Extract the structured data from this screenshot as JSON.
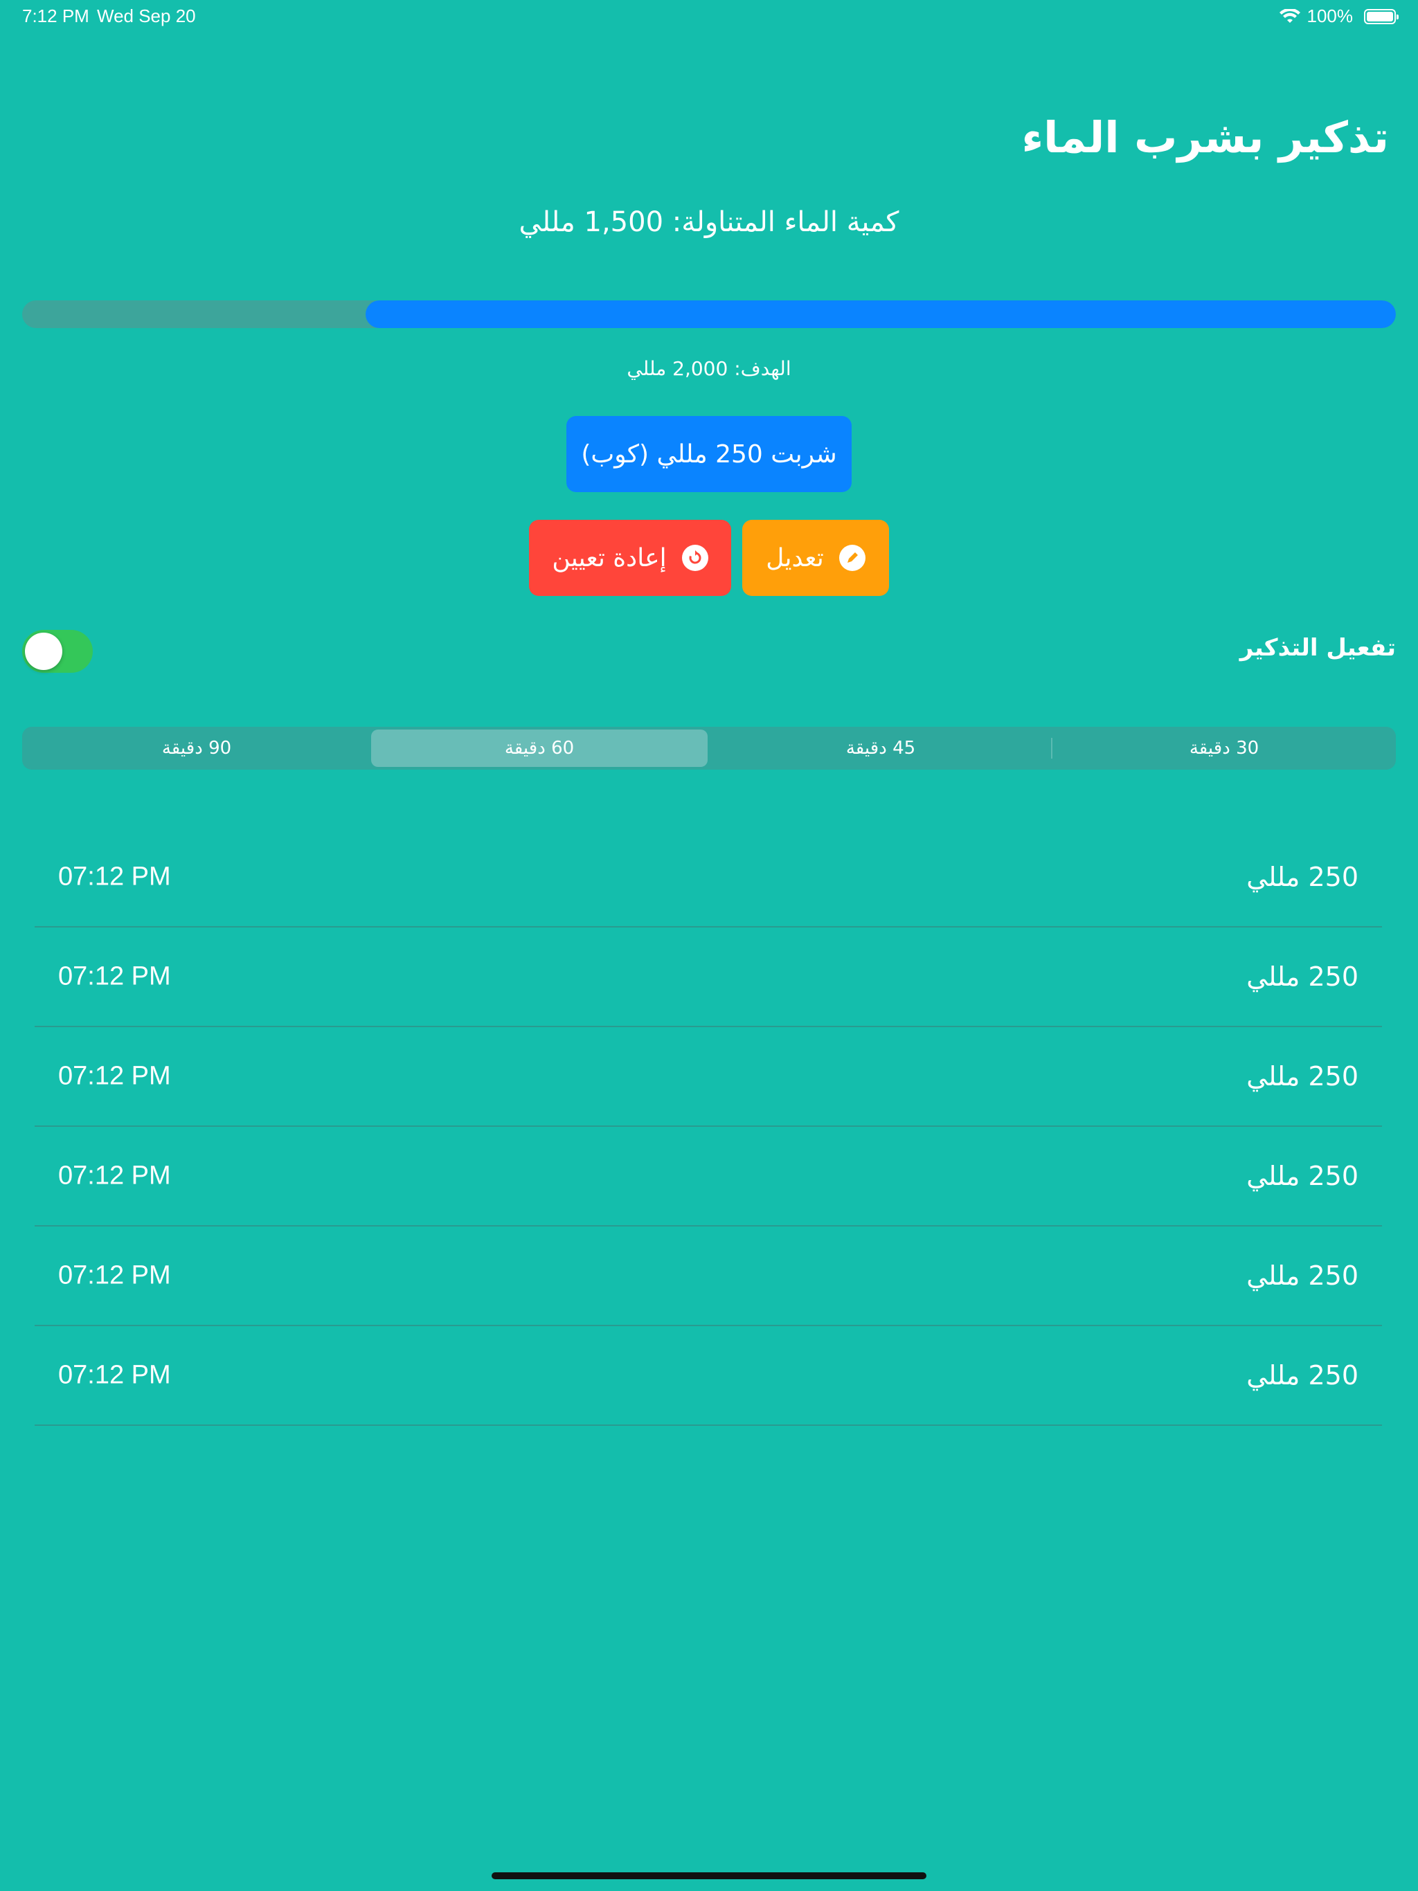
{
  "status_bar": {
    "time": "7:12 PM",
    "date": "Wed Sep 20",
    "battery": "100%",
    "wifi_icon": "wifi-icon",
    "battery_icon": "battery-icon"
  },
  "title": "تذكير بشرب الماء",
  "intake_text": "كمية الماء المتناولة: 1,500 مللي",
  "progress": {
    "fraction": 0.75,
    "fill_color": "#0A84FF",
    "track_color": "#3DA59B"
  },
  "goal_text": "الهدف: 2,000 مللي",
  "drink_button": "شربت 250 مللي (كوب)",
  "edit_button": {
    "label": "تعديل",
    "icon": "pencil-icon",
    "color": "#FF9F0A"
  },
  "reset_button": {
    "label": "إعادة تعيين",
    "icon": "reset-icon",
    "color": "#FF453A"
  },
  "reminder": {
    "label": "تفعيل التذكير",
    "enabled": true
  },
  "intervals": {
    "options": [
      "30 دقيقة",
      "45 دقيقة",
      "60 دقيقة",
      "90 دقيقة"
    ],
    "selected": "60 دقيقة"
  },
  "history": [
    {
      "amount": "250 مللي",
      "time": "07:12 PM"
    },
    {
      "amount": "250 مللي",
      "time": "07:12 PM"
    },
    {
      "amount": "250 مللي",
      "time": "07:12 PM"
    },
    {
      "amount": "250 مللي",
      "time": "07:12 PM"
    },
    {
      "amount": "250 مللي",
      "time": "07:12 PM"
    },
    {
      "amount": "250 مللي",
      "time": "07:12 PM"
    }
  ],
  "colors": {
    "background": "#14BEAC",
    "accent": "#0A84FF",
    "toggle_on": "#34C759"
  }
}
